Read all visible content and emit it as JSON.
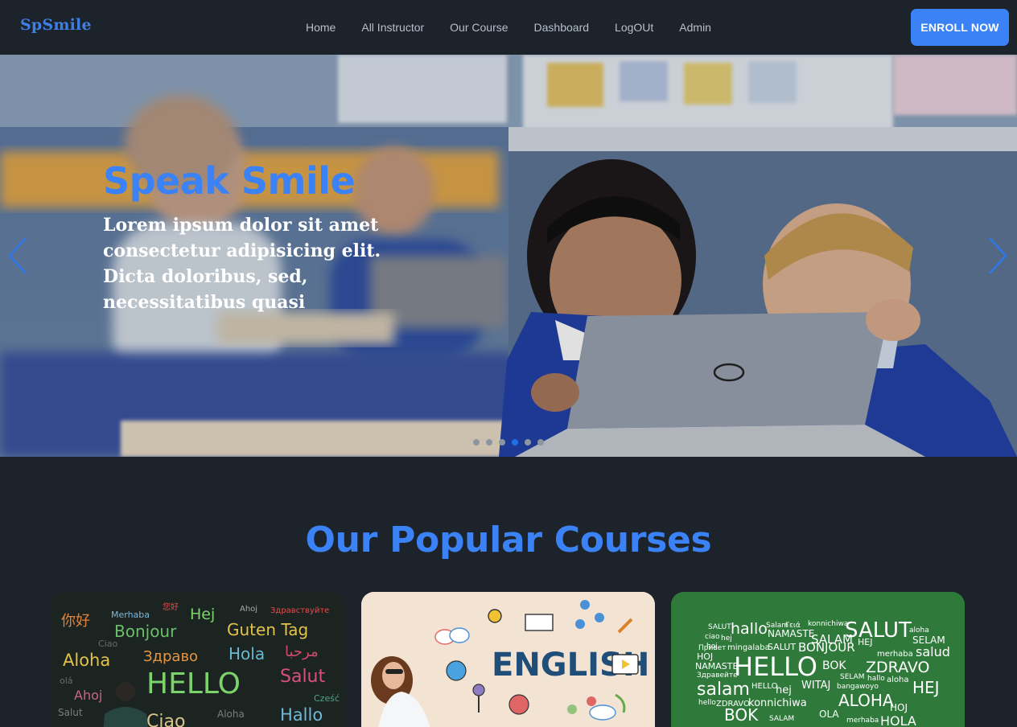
{
  "nav": {
    "brand": "SpSmile",
    "items": [
      "Home",
      "All Instructor",
      "Our Course",
      "Dashboard",
      "LogOUt",
      "Admin"
    ],
    "cta": "ENROLL NOW"
  },
  "hero": {
    "title": "Speak Smile",
    "text": "Lorem ipsum dolor sit amet consectetur adipisicing elit. Dicta doloribus, sed, necessitatibus quasi",
    "laptop_brand": "DELL",
    "slides_count": 6,
    "active_slide": 4
  },
  "courses": {
    "title": "Our Popular Courses",
    "cards": [
      {
        "image": "chalkboard-greetings",
        "words": [
          "你好",
          "Merhaba",
          "您好",
          "Hej",
          "Ahoj",
          "Здравствуйте",
          "Bonjour",
          "Guten Tag",
          "Ciao",
          "Aloha",
          "Здраво",
          "Hola",
          "مرحبا",
          "olá",
          "HELLO",
          "Salut",
          "Ahoj",
          "Cześć",
          "Salut",
          "Aloha",
          "Ciao",
          "Hallo"
        ]
      },
      {
        "image": "english-doodles",
        "label": "ENGLISH"
      },
      {
        "image": "hello-word-cloud",
        "words": [
          "SALUT",
          "hallo",
          "Salam",
          "Γειά",
          "konnichiwa",
          "SALUT",
          "aloha",
          "ciao",
          "hej",
          "NAMASTE",
          "SALAM",
          "HEJ",
          "SELAM",
          "hoj",
          "Привет",
          "mingalaba",
          "SALUT",
          "BONJOUR",
          "merhaba",
          "salud",
          "HOJ",
          "NAMASTE",
          "HELLO",
          "BOK",
          "ZDRAVO",
          "Здравейте",
          "SELAM",
          "hallo",
          "aloha",
          "salam",
          "HELLO",
          "hej",
          "HEJ",
          "hello",
          "ZDRAVO",
          "konnichiwa",
          "WITAJ",
          "bangawoyo",
          "ALOHA",
          "HOJ",
          "BOK",
          "SALAM",
          "OLA",
          "HOLA",
          "merhaba"
        ]
      }
    ]
  },
  "colors": {
    "background": "#1d232a",
    "accent": "#3b82f6",
    "nav_text": "#b8bfcb",
    "dot_active": "#1e6fe8"
  }
}
